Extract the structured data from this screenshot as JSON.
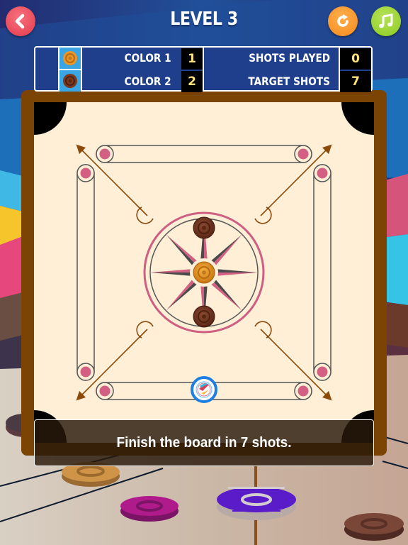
{
  "header": {
    "title": "LEVEL 3",
    "buttons": [
      {
        "name": "back",
        "icon": "chevron-left-icon",
        "color": "#e94454"
      },
      {
        "name": "restart",
        "icon": "restart-icon",
        "color": "#f89a2c"
      },
      {
        "name": "music",
        "icon": "music-note-icon",
        "color": "#9ed235"
      }
    ]
  },
  "scoreboard": {
    "rows": [
      {
        "coin_color": "#e8962a",
        "label": "COLOR 1",
        "value": "1"
      },
      {
        "coin_color": "#7b3a1f",
        "label": "COLOR 2",
        "value": "2"
      }
    ],
    "stats": [
      {
        "label": "SHOTS PLAYED",
        "value": "0"
      },
      {
        "label": "TARGET SHOTS",
        "value": "7"
      }
    ]
  },
  "board": {
    "colors": {
      "frame": "#7b4304",
      "surface": "#ffefd6",
      "pocket": "#000000",
      "line": "#555555",
      "dot": "#d35f82",
      "arrow": "#8b4a0c",
      "striker_ring": "#1e7fe0"
    },
    "pieces": [
      {
        "name": "center-coin",
        "color": "orange"
      },
      {
        "name": "top-coin",
        "color": "brown"
      },
      {
        "name": "bottom-coin",
        "color": "brown"
      }
    ],
    "striker": {
      "label": "striker"
    }
  },
  "message": {
    "text": "Finish the board in 7 shots."
  }
}
